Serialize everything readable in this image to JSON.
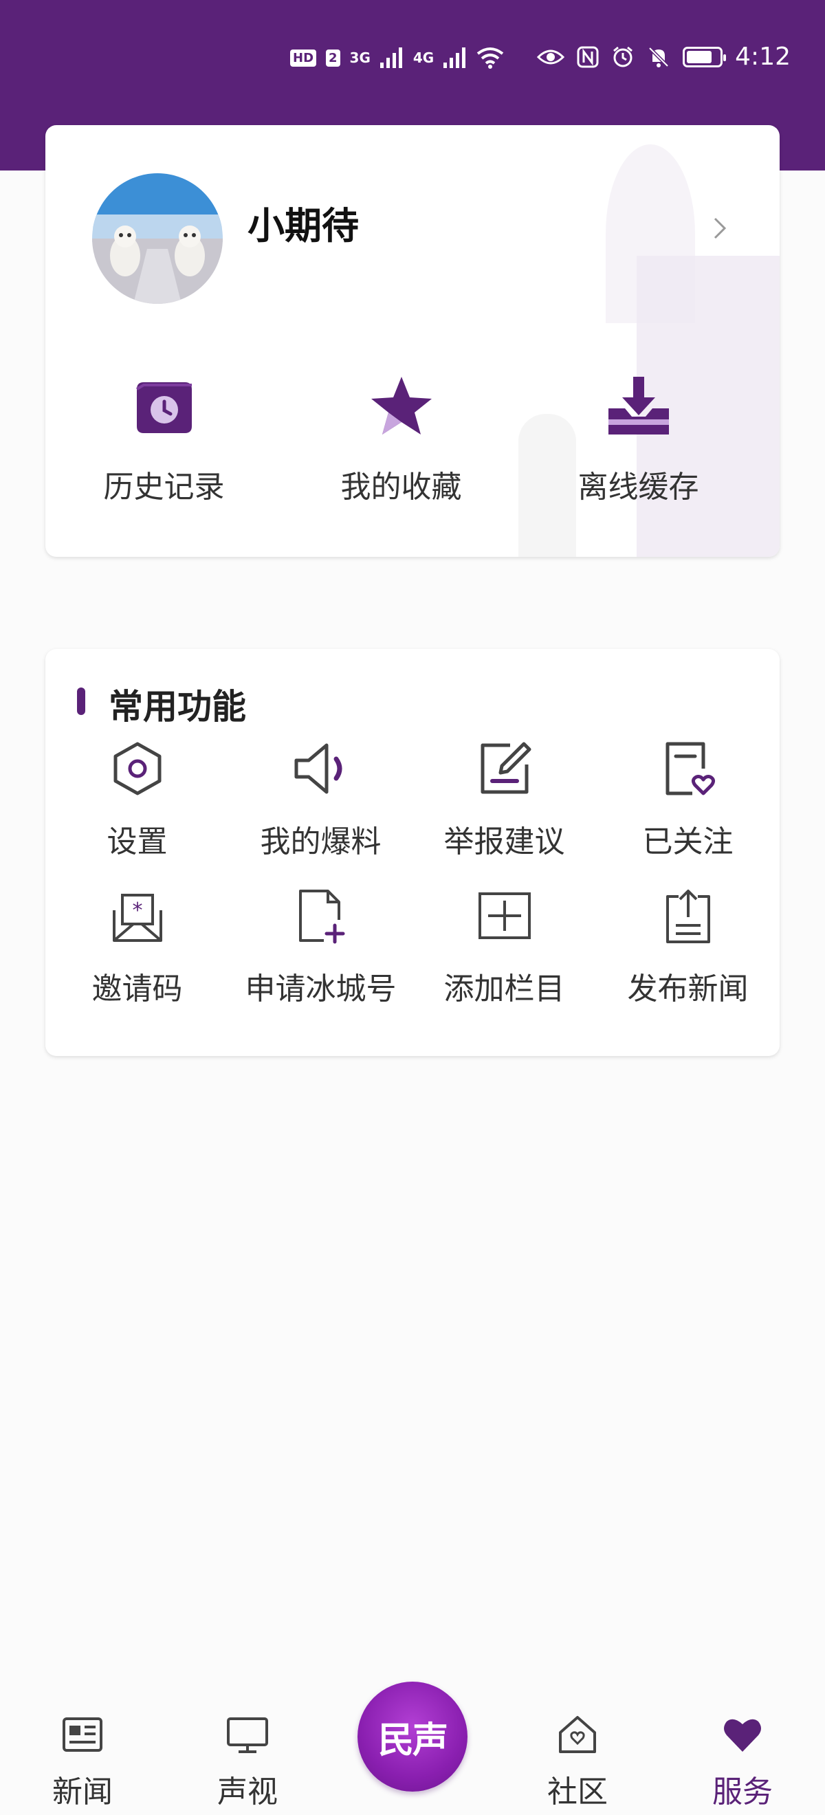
{
  "status_bar": {
    "hd_badge": "HD",
    "sim_slot": "2",
    "net1": "3G",
    "net2": "4G",
    "time": "4:12"
  },
  "profile": {
    "username": "小期待",
    "quick_actions": [
      {
        "label": "历史记录",
        "icon": "history-icon"
      },
      {
        "label": "我的收藏",
        "icon": "star-icon"
      },
      {
        "label": "离线缓存",
        "icon": "download-icon"
      }
    ]
  },
  "functions": {
    "title": "常用功能",
    "items": [
      {
        "label": "设置",
        "icon": "settings-icon"
      },
      {
        "label": "我的爆料",
        "icon": "speaker-icon"
      },
      {
        "label": "举报建议",
        "icon": "edit-icon"
      },
      {
        "label": "已关注",
        "icon": "follow-icon"
      },
      {
        "label": "邀请码",
        "icon": "invite-code-icon"
      },
      {
        "label": "申请冰城号",
        "icon": "apply-icon"
      },
      {
        "label": "添加栏目",
        "icon": "add-column-icon"
      },
      {
        "label": "发布新闻",
        "icon": "publish-icon"
      }
    ]
  },
  "nav": {
    "items": [
      {
        "label": "新闻",
        "icon": "news-icon"
      },
      {
        "label": "声视",
        "icon": "tv-icon"
      },
      {
        "label": "民声",
        "icon": "center-logo"
      },
      {
        "label": "社区",
        "icon": "community-icon"
      },
      {
        "label": "服务",
        "icon": "heart-icon"
      }
    ],
    "active": "服务"
  },
  "colors": {
    "brand": "#5a2278",
    "accent": "#8a1fb0",
    "background": "#fbfbfb"
  }
}
